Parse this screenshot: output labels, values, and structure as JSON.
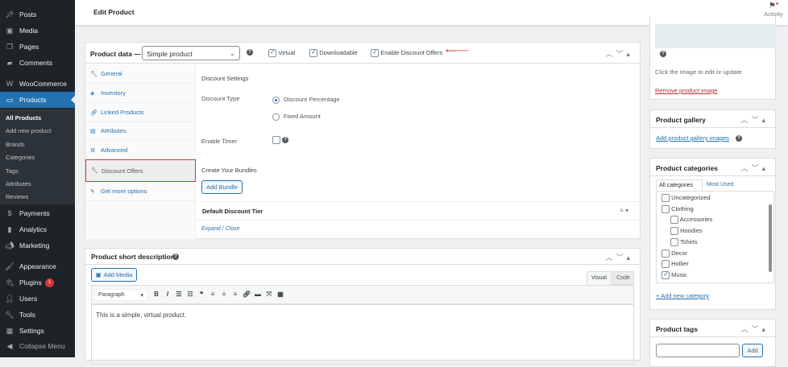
{
  "sidebar": {
    "items": [
      {
        "label": "Posts",
        "icon": "pin-icon"
      },
      {
        "label": "Media",
        "icon": "media-icon"
      },
      {
        "label": "Pages",
        "icon": "pages-icon"
      },
      {
        "label": "Comments",
        "icon": "comments-icon"
      },
      {
        "label": "WooCommerce",
        "icon": "woo-icon"
      },
      {
        "label": "Products",
        "icon": "products-icon"
      },
      {
        "label": "Payments",
        "icon": "payments-icon"
      },
      {
        "label": "Analytics",
        "icon": "analytics-icon"
      },
      {
        "label": "Marketing",
        "icon": "marketing-icon"
      },
      {
        "label": "Appearance",
        "icon": "appearance-icon"
      },
      {
        "label": "Plugins",
        "icon": "plugins-icon",
        "badge": "1"
      },
      {
        "label": "Users",
        "icon": "users-icon"
      },
      {
        "label": "Tools",
        "icon": "tools-icon"
      },
      {
        "label": "Settings",
        "icon": "settings-icon"
      },
      {
        "label": "Collapse Menu",
        "icon": "collapse-icon"
      }
    ],
    "submenu": [
      "All Products",
      "Add new product",
      "Brands",
      "Categories",
      "Tags",
      "Attributes",
      "Reviews"
    ]
  },
  "header": {
    "title": "Edit Product",
    "activity": "Activity"
  },
  "product_data": {
    "label": "Product data —",
    "type": "Simple product",
    "virtual": "Virtual",
    "downloadable": "Downloadable",
    "discount": "Enable Discount Offers",
    "tabs": [
      "General",
      "Inventory",
      "Linked Products",
      "Attributes",
      "Advanced",
      "Discount Offers",
      "Get more options"
    ],
    "panel": {
      "title": "Discount Settings",
      "discount_type": "Discount Type",
      "opt1": "Discount Percentage",
      "opt2": "Fixed Amount",
      "timer": "Enable Timer",
      "bundles": "Create Your Bundles",
      "add_bundle": "Add Bundle",
      "tier": "Default Discount Tier",
      "expand": "Expand",
      "sep": "/",
      "close": "Close"
    }
  },
  "short_desc": {
    "title": "Product short description",
    "add_media": "Add Media",
    "visual": "Visual",
    "code": "Code",
    "format": "Paragraph",
    "content": "This is a simple, virtual product."
  },
  "image_box": {
    "hint": "Click the image to edit or update",
    "remove": "Remove product image"
  },
  "gallery": {
    "title": "Product gallery",
    "add": "Add product gallery images"
  },
  "categories": {
    "title": "Product categories",
    "tab_all": "All categories",
    "tab_most": "Most Used",
    "items": [
      {
        "label": "Uncategorized",
        "checked": false,
        "child": false
      },
      {
        "label": "Clothing",
        "checked": false,
        "child": false
      },
      {
        "label": "Accessories",
        "checked": false,
        "child": true
      },
      {
        "label": "Hoodies",
        "checked": false,
        "child": true
      },
      {
        "label": "Tshirts",
        "checked": false,
        "child": true
      },
      {
        "label": "Decor",
        "checked": false,
        "child": false
      },
      {
        "label": "Hotlier",
        "checked": false,
        "child": false
      },
      {
        "label": "Music",
        "checked": true,
        "child": false
      }
    ],
    "add_new": "+ Add new category"
  },
  "tags": {
    "title": "Product tags",
    "add": "Add"
  }
}
